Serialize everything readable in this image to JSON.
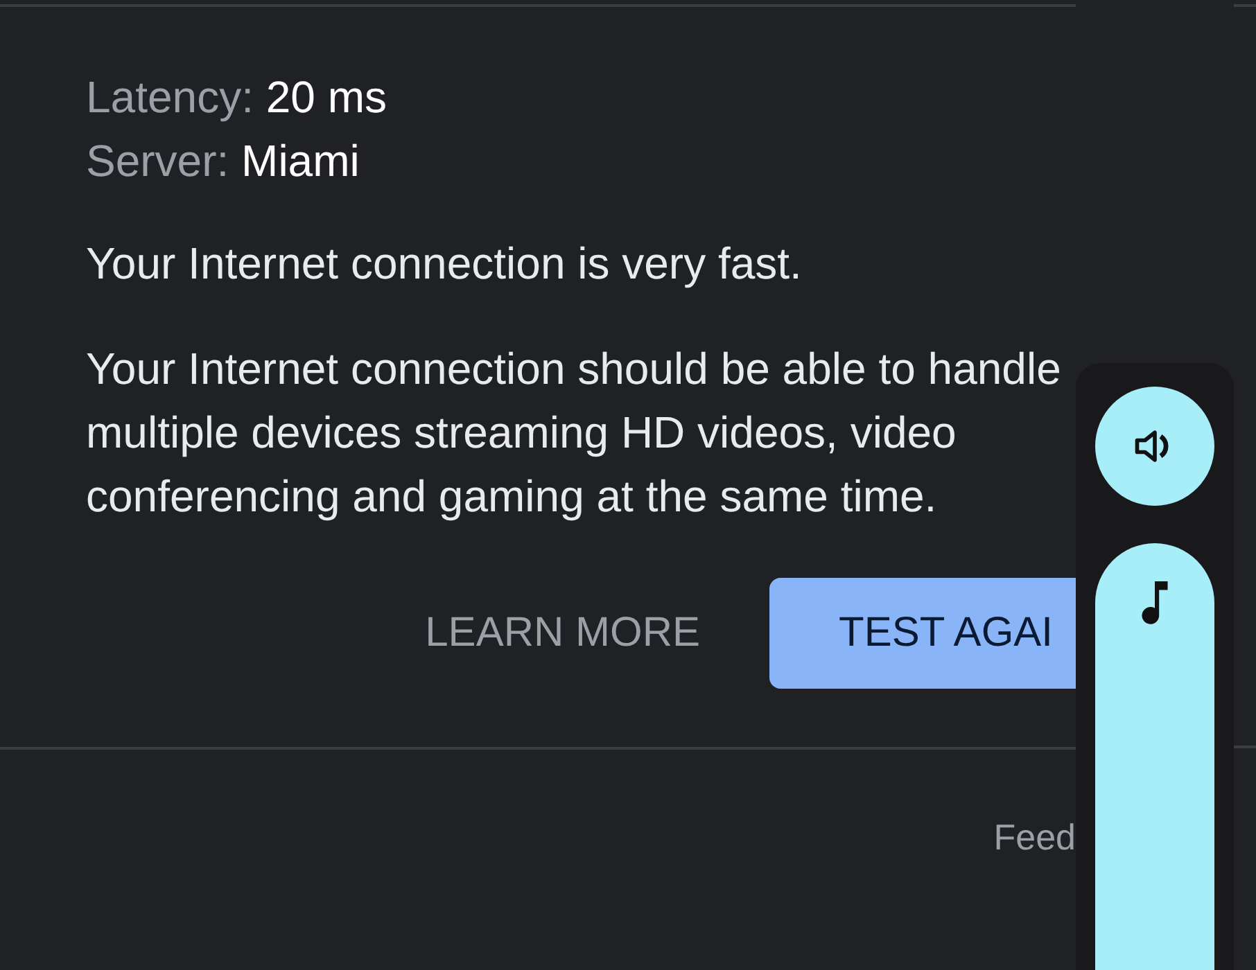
{
  "stats": [
    {
      "label": "Latency:",
      "value": "20 ms"
    },
    {
      "label": "Server:",
      "value": "Miami"
    }
  ],
  "summary": "Your Internet connection is very fast.",
  "description": "Your Internet connection should be able to handle multiple devices streaming HD videos, video conferencing and gaming at the same time.",
  "buttons": [
    {
      "label": "LEARN MORE",
      "kind": "text"
    },
    {
      "label": "TEST AGAI",
      "kind": "filled"
    }
  ],
  "footer_link": "Feed",
  "volume_slider": {
    "level": 1
  }
}
